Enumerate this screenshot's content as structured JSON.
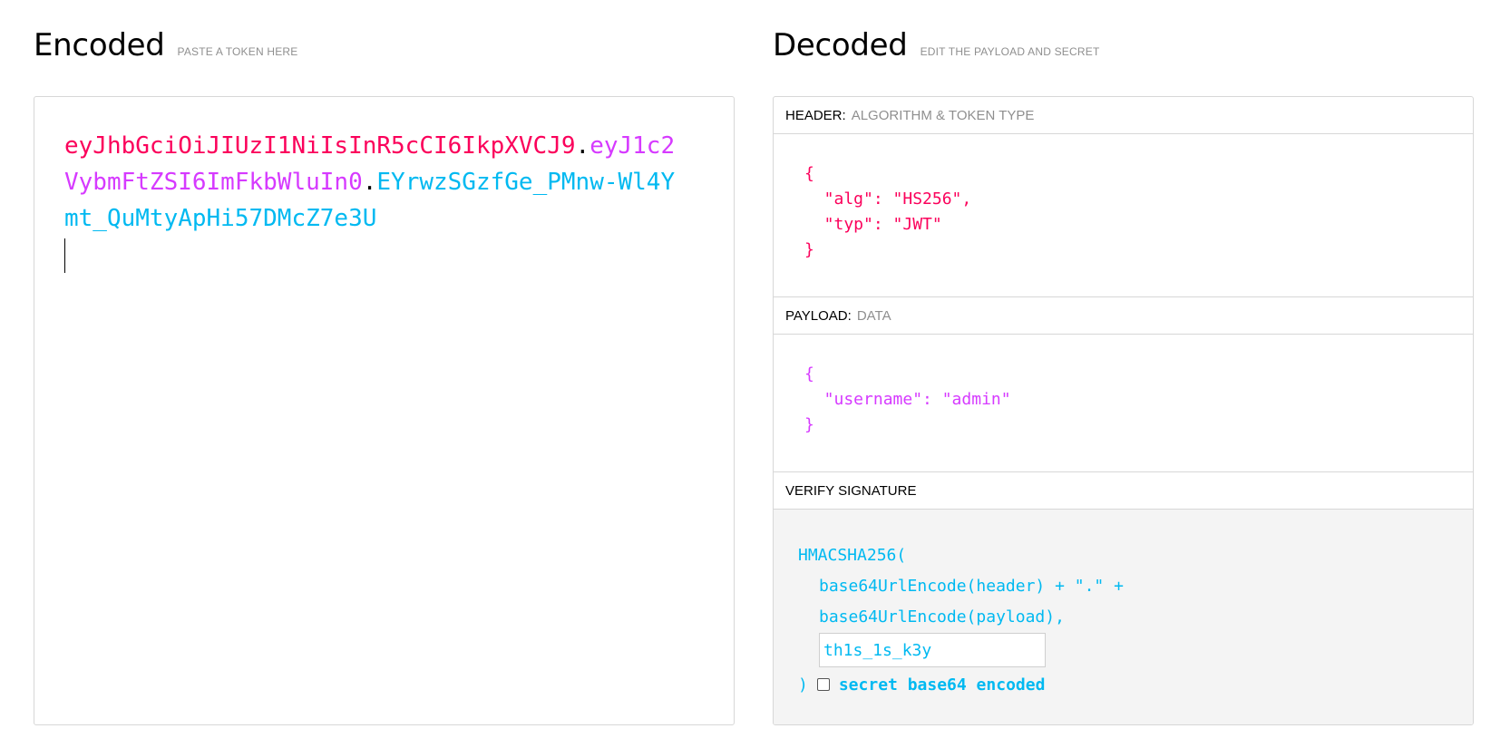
{
  "encoded": {
    "title": "Encoded",
    "subtitle": "PASTE A TOKEN HERE",
    "token_header": "eyJhbGciOiJIUzI1NiIsInR5cCI6IkpXVCJ9",
    "dot1": ".",
    "token_payload": "eyJ1c2VybmFtZSI6ImFkbWluIn0",
    "dot2": ".",
    "token_signature": "EYrwzSGzfGe_PMnw-Wl4Ymt_QuMtyApHi57DMcZ7e3U"
  },
  "decoded": {
    "title": "Decoded",
    "subtitle": "EDIT THE PAYLOAD AND SECRET",
    "header": {
      "label": "HEADER:",
      "desc": "ALGORITHM & TOKEN TYPE",
      "json": "{\n  \"alg\": \"HS256\",\n  \"typ\": \"JWT\"\n}"
    },
    "payload": {
      "label": "PAYLOAD:",
      "desc": "DATA",
      "json": "{\n  \"username\": \"admin\"\n}"
    },
    "verify": {
      "label": "VERIFY SIGNATURE",
      "fn": "HMACSHA256(",
      "line2": "base64UrlEncode(header) + \".\" +",
      "line3": "base64UrlEncode(payload),",
      "secret": "th1s_1s_k3y",
      "close": ")",
      "checkbox_label": "secret base64 encoded"
    }
  },
  "colors": {
    "header": "#fb015b",
    "payload": "#d63aff",
    "signature": "#00b9f1"
  }
}
